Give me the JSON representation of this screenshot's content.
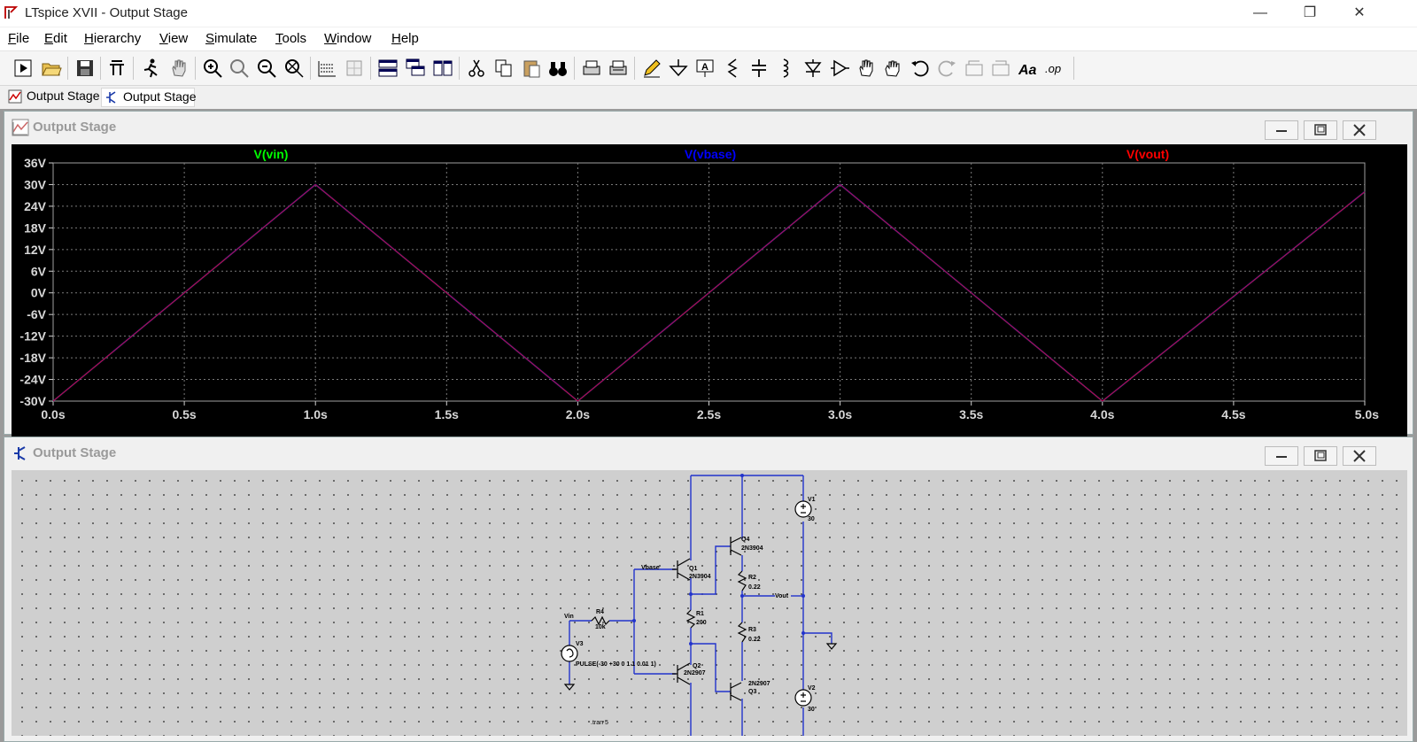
{
  "window": {
    "title": "LTspice XVII - Output Stage",
    "icon": "ltspice-logo-icon",
    "controls": [
      "minimize-icon",
      "restore-icon",
      "close-icon"
    ]
  },
  "menu": [
    {
      "label": "File",
      "mnemonic": "F",
      "rest": "ile"
    },
    {
      "label": "Edit",
      "mnemonic": "E",
      "rest": "dit"
    },
    {
      "label": "Hierarchy",
      "mnemonic": "H",
      "rest": "ierarchy"
    },
    {
      "label": "View",
      "mnemonic": "V",
      "rest": "iew"
    },
    {
      "label": "Simulate",
      "mnemonic": "S",
      "rest": "imulate"
    },
    {
      "label": "Tools",
      "mnemonic": "T",
      "rest": "ools"
    },
    {
      "label": "Window",
      "mnemonic": "W",
      "rest": "indow"
    },
    {
      "label": "Help",
      "mnemonic": "H",
      "rest": "elp"
    }
  ],
  "tabs": [
    {
      "label": "Output Stage",
      "icon": "waveform-icon",
      "active": false
    },
    {
      "label": "Output Stage",
      "icon": "schematic-icon",
      "active": true
    }
  ],
  "waveform_pane": {
    "title": "Output Stage",
    "icon": "waveform-icon"
  },
  "schematic_pane": {
    "title": "Output Stage",
    "icon": "schematic-icon"
  },
  "chart_data": {
    "type": "line",
    "xlabel": "",
    "ylabel": "",
    "x_ticks": [
      "0.0s",
      "0.5s",
      "1.0s",
      "1.5s",
      "2.0s",
      "2.5s",
      "3.0s",
      "3.5s",
      "4.0s",
      "4.5s",
      "5.0s"
    ],
    "y_ticks": [
      "36V",
      "30V",
      "24V",
      "18V",
      "12V",
      "6V",
      "0V",
      "-6V",
      "-12V",
      "-18V",
      "-24V",
      "-30V"
    ],
    "xlim": [
      0,
      5
    ],
    "ylim": [
      -30,
      36
    ],
    "grid": true,
    "legend": "top",
    "series": [
      {
        "name": "V(vin)",
        "color": "#00ff00",
        "x": [
          0,
          1,
          2,
          3,
          4,
          5
        ],
        "y": [
          -30,
          30,
          -30,
          30,
          -30,
          28
        ]
      },
      {
        "name": "V(vbase)",
        "color": "#0000ff",
        "x": [
          0,
          1,
          2,
          3,
          4,
          5
        ],
        "y": [
          -30,
          30,
          -30,
          30,
          -30,
          28
        ]
      },
      {
        "name": "V(vout)",
        "color": "#ff0000",
        "x": [
          0,
          1,
          2,
          3,
          4,
          5
        ],
        "y": [
          -30,
          30,
          -30,
          30,
          -30,
          28
        ]
      }
    ]
  },
  "schematic": {
    "labels": {
      "v1": "V1",
      "v1_val": "30",
      "v2": "V2",
      "v2_val": "30",
      "v3": "V3",
      "v3_val": "PULSE(-30 +30 0 1 1 0.01 1)",
      "q1": "Q1",
      "q1_val": "2N3904",
      "q2": "Q2",
      "q2_val": "2N2907",
      "q3": "Q3",
      "q3_val": "2N2907",
      "q4": "Q4",
      "q4_val": "2N3904",
      "r1": "R1",
      "r1_val": "200",
      "r2": "R2",
      "r2_val": "0.22",
      "r3": "R3",
      "r3_val": "0.22",
      "r4": "R4",
      "r4_val": "10k",
      "vin": "Vin",
      "vbase": "Vbase",
      "vout": "Vout",
      "tran": ".tran 5"
    }
  }
}
